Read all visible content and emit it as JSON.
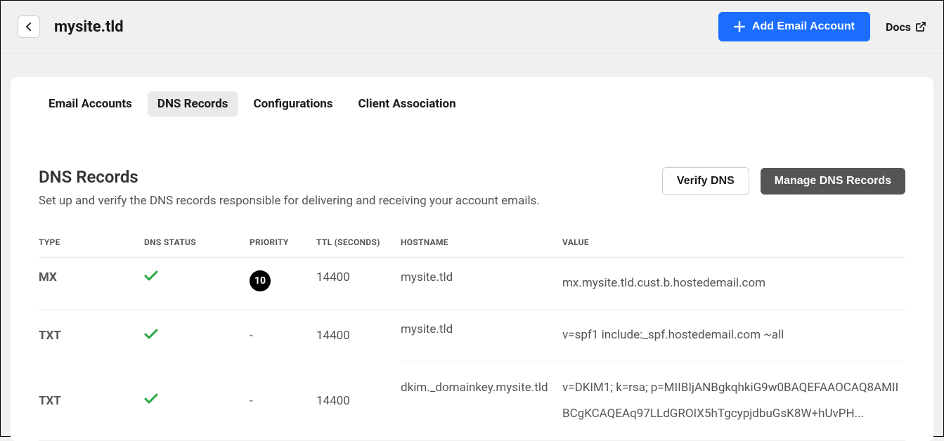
{
  "header": {
    "title": "mysite.tld",
    "add_button": "Add Email Account",
    "docs": "Docs"
  },
  "tabs": [
    {
      "label": "Email Accounts",
      "active": false
    },
    {
      "label": "DNS Records",
      "active": true
    },
    {
      "label": "Configurations",
      "active": false
    },
    {
      "label": "Client Association",
      "active": false
    }
  ],
  "section": {
    "title": "DNS Records",
    "description": "Set up and verify the DNS records responsible for delivering and receiving your account emails.",
    "verify_btn": "Verify DNS",
    "manage_btn": "Manage DNS Records"
  },
  "table": {
    "headers": {
      "type": "TYPE",
      "status": "DNS STATUS",
      "priority": "PRIORITY",
      "ttl": "TTL (SECONDS)",
      "hostname": "HOSTNAME",
      "value": "VALUE"
    },
    "rows": [
      {
        "type": "MX",
        "status": "ok",
        "priority": "10",
        "ttl": "14400",
        "hostname": "mysite.tld",
        "value": "mx.mysite.tld.cust.b.hostedemail.com"
      },
      {
        "type": "TXT",
        "status": "ok",
        "priority": "-",
        "ttl": "14400",
        "hostname": "mysite.tld",
        "value": "v=spf1 include:_spf.hostedemail.com ~all"
      },
      {
        "type": "TXT",
        "status": "ok",
        "priority": "-",
        "ttl": "14400",
        "hostname": "dkim._domainkey.mysite.tld",
        "value": "v=DKIM1; k=rsa; p=MIIBIjANBgkqhkiG9w0BAQEFAAOCAQ8AMIIBCgKCAQEAq97LLdGROIX5hTgcypjdbuGsK8W+hUvPH..."
      }
    ]
  }
}
